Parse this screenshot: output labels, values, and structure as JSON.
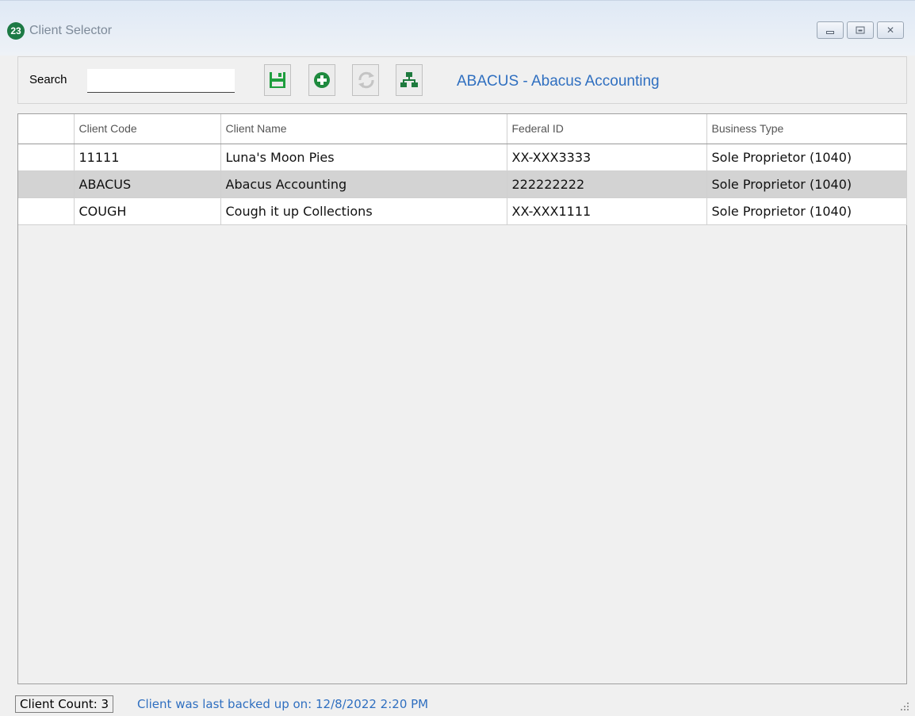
{
  "window": {
    "title": "Client Selector",
    "app_icon_text": "23",
    "colors": {
      "title_text": "#7d8a99",
      "accent": "#2f6fc0",
      "icon_green": "#1d7a45"
    }
  },
  "toolbar": {
    "search_label": "Search",
    "search_value": "",
    "buttons": [
      {
        "name": "save-icon",
        "enabled": true
      },
      {
        "name": "add-icon",
        "enabled": true
      },
      {
        "name": "refresh-icon",
        "enabled": false
      },
      {
        "name": "hierarchy-icon",
        "enabled": true
      }
    ],
    "current_client": "ABACUS - Abacus Accounting"
  },
  "grid": {
    "columns": [
      "Client Code",
      "Client Name",
      "Federal ID",
      "Business Type"
    ],
    "rows": [
      {
        "code": "11111",
        "name": "Luna's Moon Pies",
        "federal_id": "XX-XXX3333",
        "business_type": "Sole Proprietor (1040)",
        "selected": false
      },
      {
        "code": "ABACUS",
        "name": "Abacus Accounting",
        "federal_id": "222222222",
        "business_type": "Sole Proprietor (1040)",
        "selected": true
      },
      {
        "code": "COUGH",
        "name": "Cough it up Collections",
        "federal_id": "XX-XXX1111",
        "business_type": "Sole Proprietor (1040)",
        "selected": false
      }
    ]
  },
  "status": {
    "client_count": "Client Count: 3",
    "backup_text": "Client was last backed up on: 12/8/2022 2:20 PM"
  }
}
